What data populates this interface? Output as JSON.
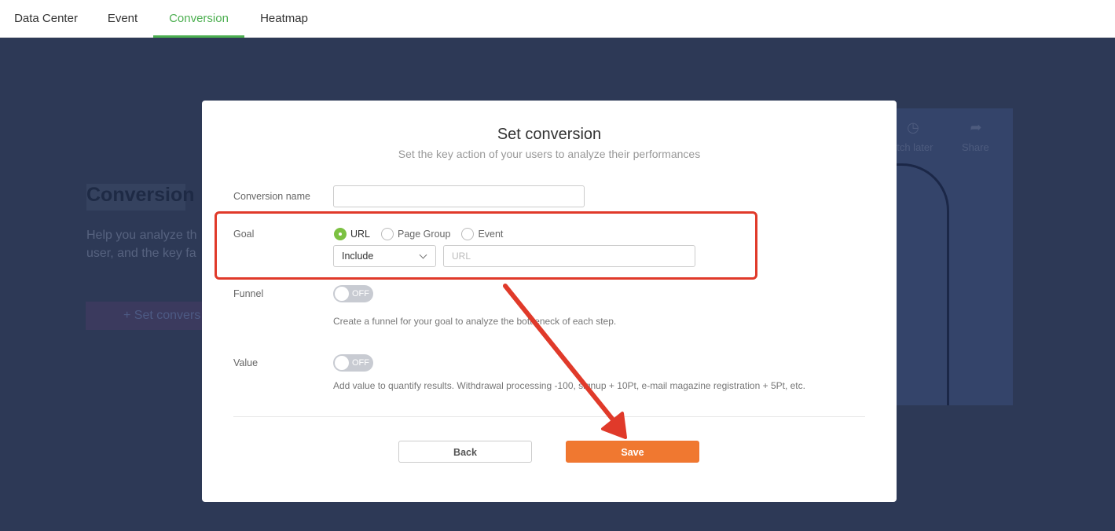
{
  "nav": {
    "tabs": [
      {
        "label": "Data Center"
      },
      {
        "label": "Event"
      },
      {
        "label": "Conversion"
      },
      {
        "label": "Heatmap"
      }
    ],
    "active_tab": "Conversion"
  },
  "background": {
    "title": "Conversion",
    "description_line1": "Help you analyze th",
    "description_line2": "user, and the key fa",
    "button_label": "+ Set convers",
    "video": {
      "watch_later": "atch later",
      "share": "Share"
    }
  },
  "modal": {
    "title": "Set conversion",
    "subtitle": "Set the key action of your users to analyze their performances",
    "conversion_name": {
      "label": "Conversion name",
      "value": ""
    },
    "goal": {
      "label": "Goal",
      "options": [
        {
          "label": "URL",
          "checked": true
        },
        {
          "label": "Page Group",
          "checked": false
        },
        {
          "label": "Event",
          "checked": false
        }
      ],
      "match_select": "Include",
      "url_placeholder": "URL"
    },
    "funnel": {
      "label": "Funnel",
      "toggle": "OFF",
      "hint": "Create a funnel for your goal to analyze the bottleneck of each step."
    },
    "value": {
      "label": "Value",
      "toggle": "OFF",
      "hint": "Add value to quantify results. Withdrawal processing -100, signup + 10Pt, e-mail magazine registration + 5Pt, etc."
    },
    "back_label": "Back",
    "save_label": "Save"
  },
  "colors": {
    "accent_green": "#4caf50",
    "save_orange": "#f07830",
    "annotation_red": "#e03a2a",
    "backdrop": "#2d3956"
  }
}
